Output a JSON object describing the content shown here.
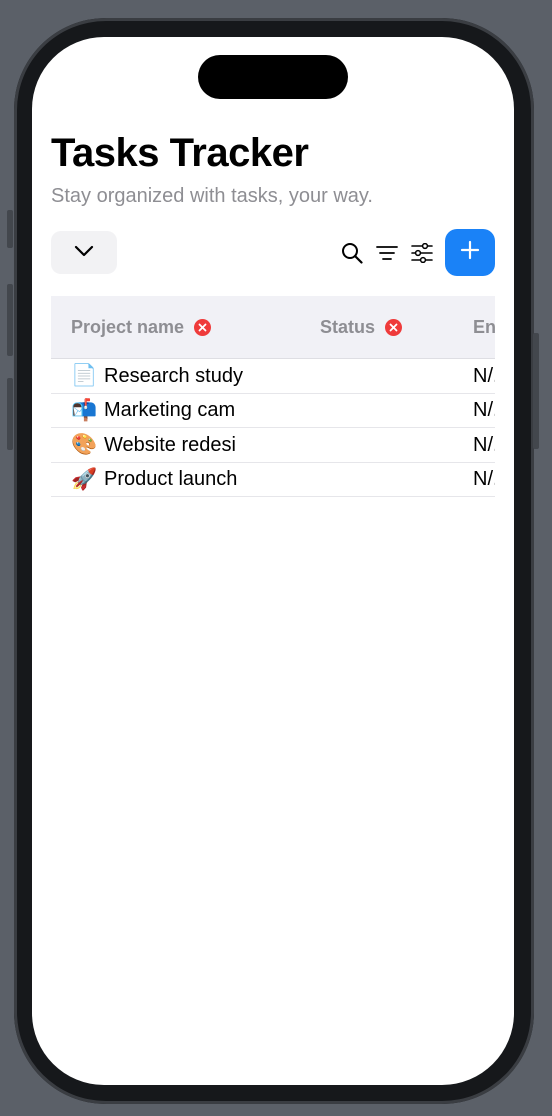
{
  "app": {
    "title": "Tasks Tracker",
    "subtitle": "Stay organized with tasks, your way."
  },
  "toolbar": {
    "dropdown_icon": "chevron-down-icon",
    "search_icon": "search-icon",
    "sort_icon": "sort-lines-icon",
    "filter_icon": "sliders-icon",
    "add_icon": "plus-icon",
    "add_color": "#1a82f7"
  },
  "table": {
    "columns": [
      {
        "label": "Project name",
        "removable": true
      },
      {
        "label": "Status",
        "removable": true
      },
      {
        "label": "En",
        "removable": false
      }
    ],
    "rows": [
      {
        "emoji": "📄",
        "name": "Research study",
        "status": "",
        "end": "N/."
      },
      {
        "emoji": "📬",
        "name": "Marketing cam",
        "status": "",
        "end": "N/."
      },
      {
        "emoji": "🎨",
        "name": "Website redesi",
        "status": "",
        "end": "N/."
      },
      {
        "emoji": "🚀",
        "name": "Product launch",
        "status": "",
        "end": "N/."
      }
    ]
  },
  "colors": {
    "remove_badge": "#ef3b3b",
    "header_bg": "#f1f1f6"
  }
}
